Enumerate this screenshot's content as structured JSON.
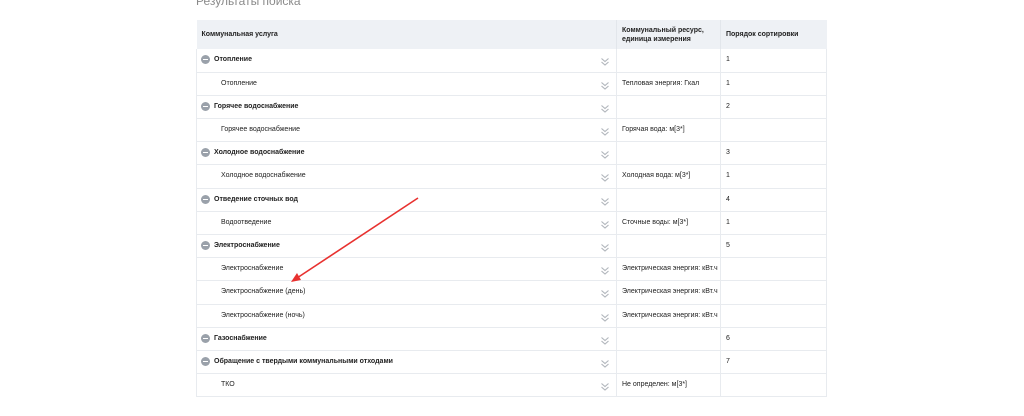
{
  "section_title": "Результаты поиска",
  "table": {
    "headers": {
      "service": "Коммунальная услуга",
      "resource": "Коммунальный ресурс, единица измерения",
      "sort_order": "Порядок сортировки"
    },
    "rows": [
      {
        "type": "group",
        "service": "Отопление",
        "resource": "",
        "sort_order": "1"
      },
      {
        "type": "child",
        "service": "Отопление",
        "resource": "Тепловая энергия: Гкал",
        "sort_order": "1"
      },
      {
        "type": "group",
        "service": "Горячее водоснабжение",
        "resource": "",
        "sort_order": "2"
      },
      {
        "type": "child",
        "service": "Горячее водоснабжение",
        "resource": "Горячая вода: м[3*]",
        "sort_order": ""
      },
      {
        "type": "group",
        "service": "Холодное водоснабжение",
        "resource": "",
        "sort_order": "3"
      },
      {
        "type": "child",
        "service": "Холодное водоснабжение",
        "resource": "Холодная вода: м[3*]",
        "sort_order": "1"
      },
      {
        "type": "group",
        "service": "Отведение сточных вод",
        "resource": "",
        "sort_order": "4"
      },
      {
        "type": "child",
        "service": "Водоотведение",
        "resource": "Сточные воды: м[3*]",
        "sort_order": "1"
      },
      {
        "type": "group",
        "service": "Электроснабжение",
        "resource": "",
        "sort_order": "5"
      },
      {
        "type": "child",
        "service": "Электроснабжение",
        "resource": "Электрическая энергия: кВт.ч",
        "sort_order": ""
      },
      {
        "type": "child",
        "service": "Электроснабжение (день)",
        "resource": "Электрическая энергия: кВт.ч",
        "sort_order": ""
      },
      {
        "type": "child",
        "service": "Электроснабжение (ночь)",
        "resource": "Электрическая энергия: кВт.ч",
        "sort_order": ""
      },
      {
        "type": "group",
        "service": "Газоснабжение",
        "resource": "",
        "sort_order": "6"
      },
      {
        "type": "group",
        "service": "Обращение с твердыми коммунальными отходами",
        "resource": "",
        "sort_order": "7"
      },
      {
        "type": "child",
        "service": "ТКО",
        "resource": "Не определен: м[3*]",
        "sort_order": ""
      }
    ]
  },
  "icons": {
    "toggle": "collapse-circle-icon",
    "expand": "double-chevron-down-icon"
  },
  "colors": {
    "header_bg": "#eef1f5",
    "annotation_arrow": "#e8312f"
  }
}
